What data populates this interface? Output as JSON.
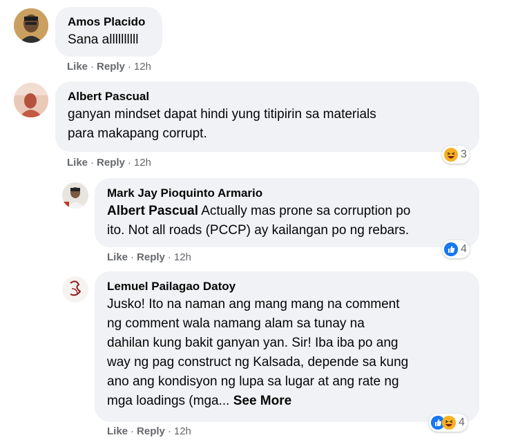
{
  "comments": [
    {
      "author": "Amos Placido",
      "text": "Sana allllllllll",
      "actions": {
        "like": "Like",
        "reply": "Reply",
        "time": "12h"
      }
    },
    {
      "author": "Albert Pascual",
      "text_line1": "ganyan mindset dapat hindi yung titipirin sa materials",
      "text_line2": "para makapang corrupt.",
      "actions": {
        "like": "Like",
        "reply": "Reply",
        "time": "12h"
      },
      "reactions": {
        "icons": [
          "haha-icon"
        ],
        "count": "3"
      }
    },
    {
      "author": "Mark Jay Pioquinto Armario",
      "mention": "Albert Pascual",
      "text_line1": " Actually mas prone sa corruption po",
      "text_line2": "ito. Not all roads (PCCP) ay kailangan po ng rebars.",
      "actions": {
        "like": "Like",
        "reply": "Reply",
        "time": "12h"
      },
      "reactions": {
        "icons": [
          "like-icon"
        ],
        "count": "4"
      }
    },
    {
      "author": "Lemuel Pailagao Datoy",
      "lines": [
        "Jusko! Ito na naman ang mang mang na comment",
        "ng comment wala namang alam sa tunay na",
        "dahilan kung bakit ganyan yan. Sir! Iba iba po ang",
        "way ng pag construct ng Kalsada, depende sa kung",
        "ano ang kondisyon ng lupa sa lugar at ang rate ng",
        "mga loadings (mga... "
      ],
      "see_more": "See More",
      "actions": {
        "like": "Like",
        "reply": "Reply",
        "time": "12h"
      },
      "reactions": {
        "icons": [
          "like-icon",
          "haha-icon"
        ],
        "count": "4"
      }
    }
  ],
  "colors": {
    "bubble": "#f0f2f5",
    "meta": "#65676b",
    "like_blue": "#1877f2",
    "haha_yellow": "#f7b125"
  }
}
